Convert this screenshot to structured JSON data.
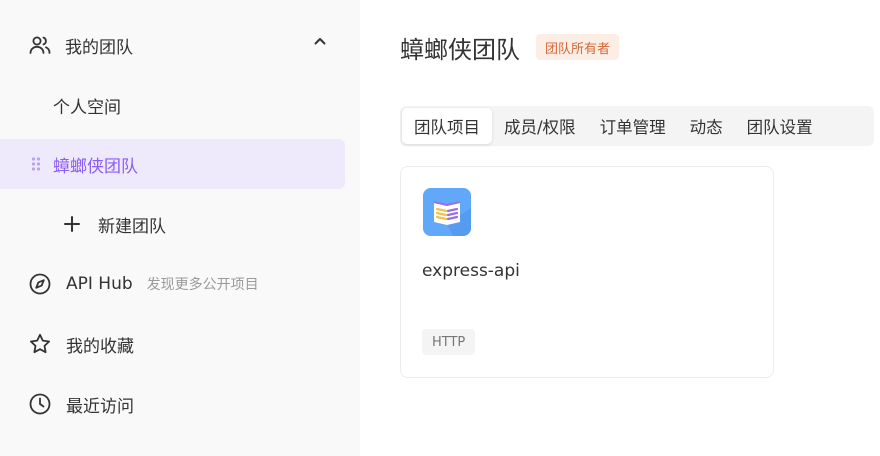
{
  "sidebar": {
    "team_section": {
      "label": "我的团队"
    },
    "personal_space": "个人空间",
    "active_team": "蟑螂侠团队",
    "new_team": "新建团队",
    "api_hub": {
      "label": "API Hub",
      "subtitle": "发现更多公开项目"
    },
    "favorites": "我的收藏",
    "recent": "最近访问"
  },
  "main": {
    "title": "蟑螂侠团队",
    "role_badge": "团队所有者",
    "tabs": [
      {
        "label": "团队项目",
        "active": true
      },
      {
        "label": "成员/权限",
        "active": false
      },
      {
        "label": "订单管理",
        "active": false
      },
      {
        "label": "动态",
        "active": false
      },
      {
        "label": "团队设置",
        "active": false
      }
    ],
    "projects": [
      {
        "name": "express-api",
        "tag": "HTTP"
      }
    ]
  },
  "colors": {
    "accent": "#8b5cf6",
    "active_bg": "#efeafb",
    "badge_bg": "#fdeee5",
    "badge_text": "#d2683a",
    "project_icon": "#62a8f8"
  }
}
